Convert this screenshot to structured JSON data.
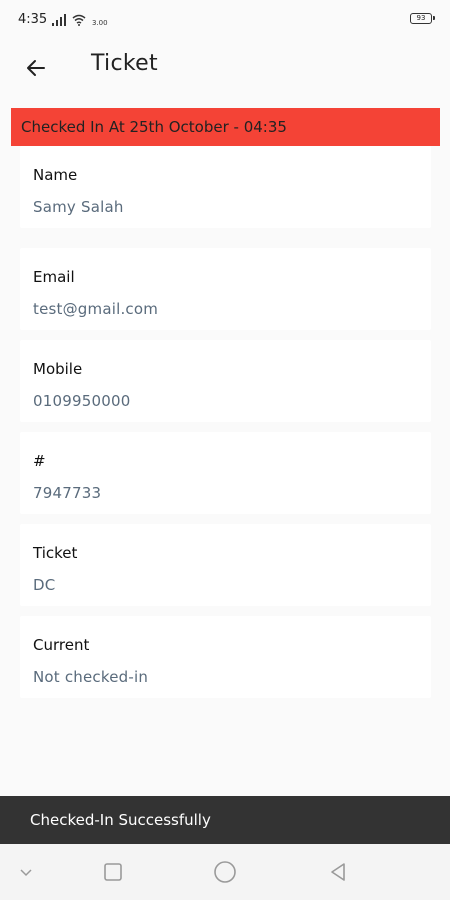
{
  "status_bar": {
    "time": "4:35",
    "battery": "93",
    "speed": "3.00"
  },
  "app_bar": {
    "title": "Ticket",
    "back_icon": "back-arrow-icon"
  },
  "banner": {
    "text": "Checked In At 25th October - 04:35",
    "color": "#f44336"
  },
  "fields": [
    {
      "label": "Name",
      "value": "Samy Salah"
    },
    {
      "label": "Email",
      "value": "test@gmail.com"
    },
    {
      "label": "Mobile",
      "value": "0109950000"
    },
    {
      "label": "#",
      "value": "7947733"
    },
    {
      "label": "Ticket",
      "value": "DC"
    },
    {
      "label": "Current",
      "value": "Not checked-in"
    }
  ],
  "snackbar": {
    "text": "Checked-In Successfully"
  },
  "nav": {
    "icons": [
      "chevron-down-icon",
      "recents-icon",
      "home-icon",
      "back-triangle-icon"
    ]
  }
}
